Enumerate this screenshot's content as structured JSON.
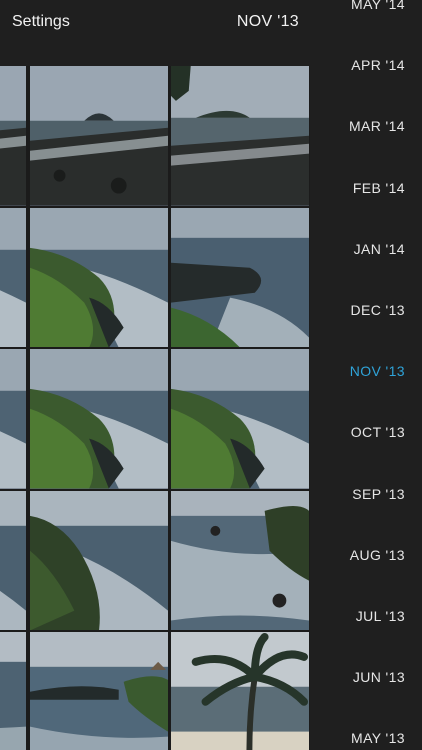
{
  "header": {
    "settings_label": "Settings",
    "current_month": "NOV '13"
  },
  "timeline": {
    "months": [
      "MAY '14",
      "APR '14",
      "MAR '14",
      "FEB '14",
      "JAN '14",
      "DEC '13",
      "NOV '13",
      "OCT '13",
      "SEP '13",
      "AUG '13",
      "JUL '13",
      "JUN '13",
      "MAY '13"
    ],
    "active_month": "NOV '13",
    "active_color": "#2fa3d8"
  },
  "grid": {
    "rows": 5,
    "columns": 3,
    "photos": [
      {
        "subject": "rocky-shore-islet"
      },
      {
        "subject": "rocky-shore-islet"
      },
      {
        "subject": "rocky-shore-tree"
      },
      {
        "subject": "green-cliff-waves"
      },
      {
        "subject": "green-cliff-waves"
      },
      {
        "subject": "dark-rocks-waves"
      },
      {
        "subject": "green-cliff-waves"
      },
      {
        "subject": "green-cliff-waves"
      },
      {
        "subject": "green-cliff-waves"
      },
      {
        "subject": "cliff-surf"
      },
      {
        "subject": "cliff-surf"
      },
      {
        "subject": "surf-rocks"
      },
      {
        "subject": "coast-rocks"
      },
      {
        "subject": "coast-rocks-hut"
      },
      {
        "subject": "palm-tree-beach"
      }
    ]
  }
}
